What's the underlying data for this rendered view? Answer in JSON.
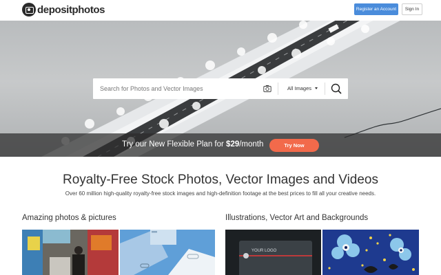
{
  "header": {
    "logo_text": "depositphotos",
    "register_label": "Register an Account",
    "signin_label": "Sign In",
    "colors": {
      "register_bg": "#4a8cdb"
    }
  },
  "search": {
    "placeholder": "Search for Photos and Vector Images",
    "filter_selected": "All Images",
    "camera_icon": "camera-icon",
    "search_icon": "search-icon"
  },
  "promo": {
    "text_before": "Try our New Flexible Plan for ",
    "price": "$29",
    "text_after": "/month",
    "button_label": "Try Now",
    "colors": {
      "button_bg": "#f26a4b"
    }
  },
  "main": {
    "title": "Royalty-Free Stock Photos, Vector Images and Videos",
    "subtitle": "Over 60 million high-quality royalty-free stock images and high-definition footage at the best prices to fill all your creative needs."
  },
  "sections": {
    "photos_title": "Amazing photos & pictures",
    "vectors_title": "Illustrations, Vector Art and Backgrounds"
  },
  "thumbnails": {
    "card_logo_text": "YOUR LOGO"
  }
}
